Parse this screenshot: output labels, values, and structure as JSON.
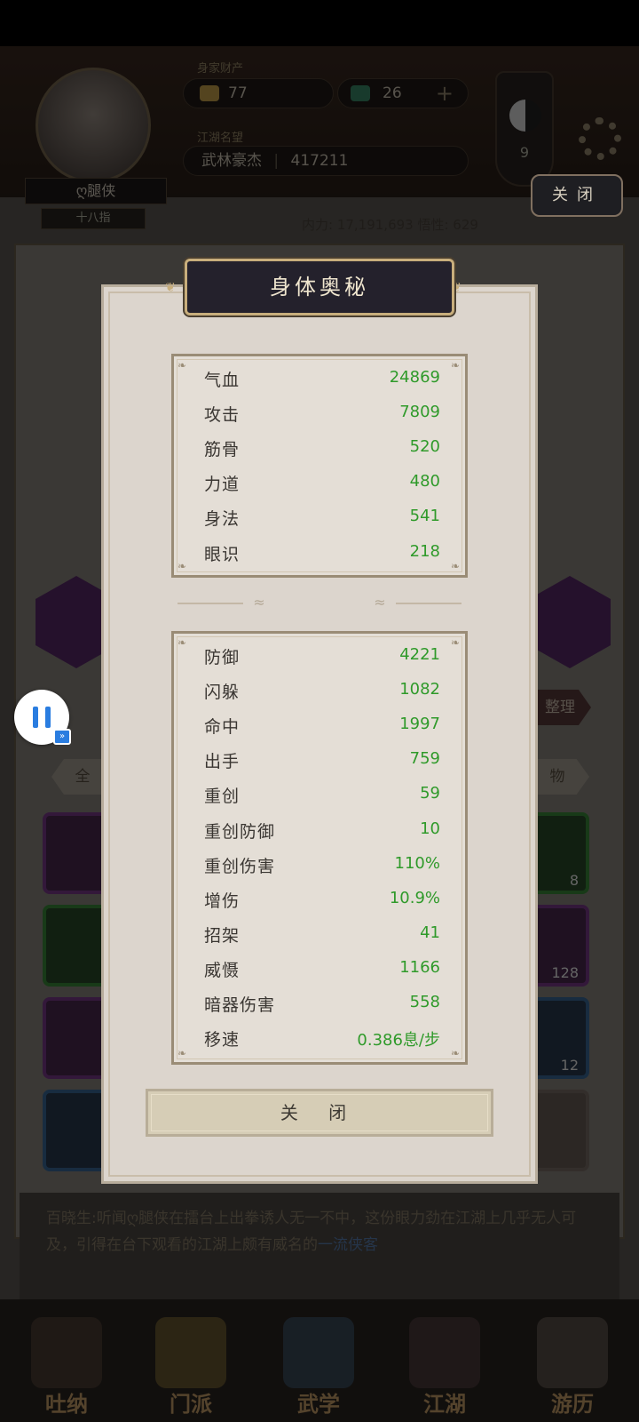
{
  "background": {
    "player_name": "ღ腿侠",
    "player_subtitle": "十八指",
    "currency_label": "身家财产",
    "gold_amount": "77",
    "jade_amount": "26",
    "fame_label": "江湖名望",
    "fame_rank": "武林豪杰",
    "fame_value": "417211",
    "taiji_level": "9",
    "power_line": "内力: 17,191,693  悟性: 629",
    "close_label": "关闭",
    "tab_all": "全",
    "tab_items": "物",
    "sort_label": "整理",
    "slot_counts": [
      "8",
      "128",
      "12"
    ],
    "news_text": "百晓生:听闻ღ腿侠在擂台上出拳诱人无一不中，这份眼力劲在江湖上几乎无人可及，引得在台下观看的江湖上颇有威名的",
    "news_link": "一流侠客",
    "nav": [
      "吐纳",
      "门派",
      "武学",
      "江湖",
      "游历"
    ]
  },
  "modal": {
    "title": "身体奥秘",
    "primary_stats": [
      {
        "label": "气血",
        "value": "24869"
      },
      {
        "label": "攻击",
        "value": "7809"
      },
      {
        "label": "筋骨",
        "value": "520"
      },
      {
        "label": "力道",
        "value": "480"
      },
      {
        "label": "身法",
        "value": "541"
      },
      {
        "label": "眼识",
        "value": "218"
      }
    ],
    "secondary_stats": [
      {
        "label": "防御",
        "value": "4221"
      },
      {
        "label": "闪躲",
        "value": "1082"
      },
      {
        "label": "命中",
        "value": "1997"
      },
      {
        "label": "出手",
        "value": "759"
      },
      {
        "label": "重创",
        "value": "59"
      },
      {
        "label": "重创防御",
        "value": "10"
      },
      {
        "label": "重创伤害",
        "value": "110%"
      },
      {
        "label": "增伤",
        "value": "10.9%"
      },
      {
        "label": "招架",
        "value": "41"
      },
      {
        "label": "威慑",
        "value": "1166"
      },
      {
        "label": "暗器伤害",
        "value": "558"
      },
      {
        "label": "移速",
        "value": "0.386息/步"
      }
    ],
    "close_label": "关 闭"
  },
  "colors": {
    "stat_value": "#2f9a2a",
    "title_plate": "#24212c",
    "modal_bg": "#dcd5cd"
  }
}
